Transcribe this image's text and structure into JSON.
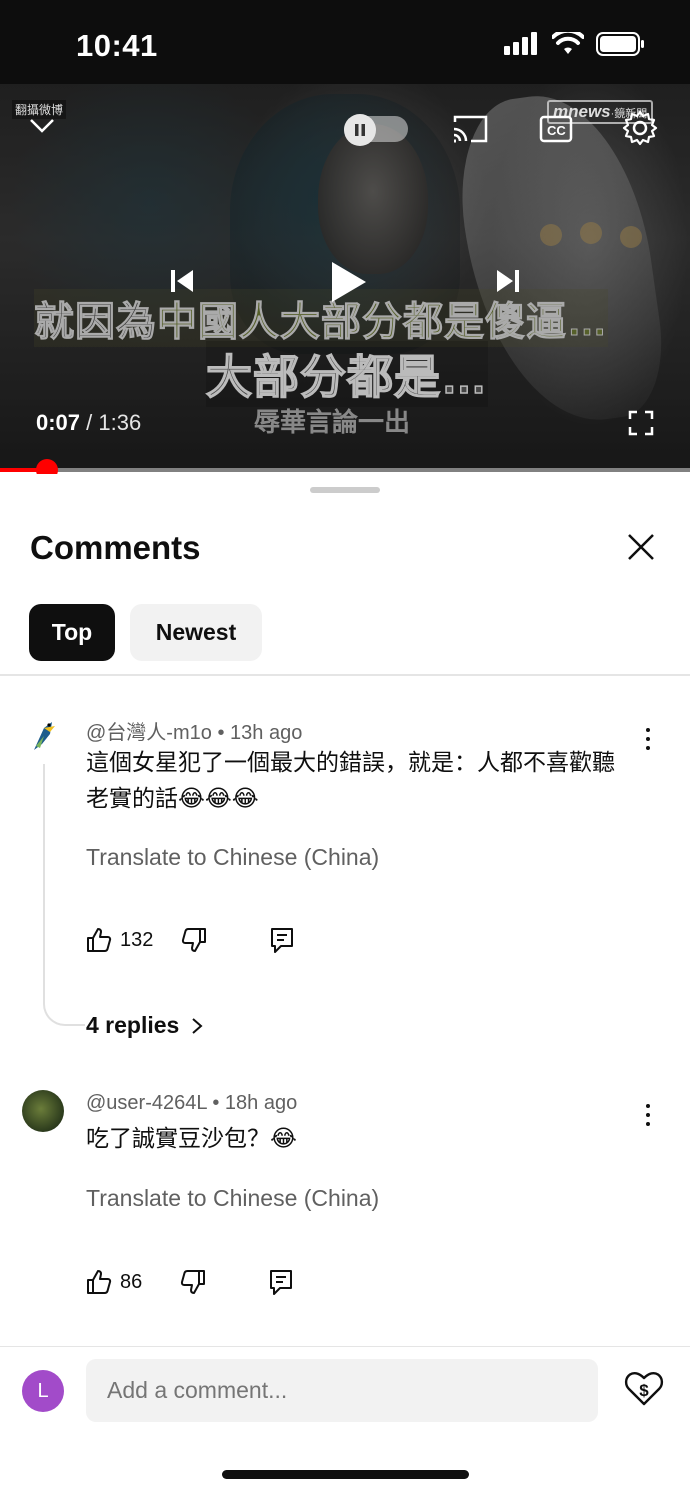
{
  "status_bar": {
    "time": "10:41",
    "icons": [
      "cellular-signal-icon",
      "wifi-icon",
      "battery-icon"
    ]
  },
  "player": {
    "watermark_left": "翻攝微博",
    "watermark_brand": "mnews",
    "watermark_brand_sub": "·鏡新聞",
    "subtitle_line1_a": "就因為",
    "subtitle_line1_b": "中國人大部分都是傻逼…",
    "subtitle_line2": "大部分都是…",
    "subtitle_line3": "辱華言論一出",
    "current_time": "0:07",
    "separator": " / ",
    "duration": "1:36",
    "progress": 0.068,
    "accent_color": "#ff0000",
    "controls": [
      "chevron-down-icon",
      "autoplay-toggle",
      "cast-icon",
      "captions-icon",
      "settings-gear-icon",
      "previous-icon",
      "play-icon",
      "next-icon",
      "fullscreen-icon"
    ]
  },
  "comments_panel": {
    "title": "Comments",
    "tabs": [
      {
        "label": "Top",
        "selected": true
      },
      {
        "label": "Newest",
        "selected": false
      }
    ],
    "comments": [
      {
        "author": "@台灣人-m1o",
        "dot": "•",
        "time": "13h ago",
        "text": "這個女星犯了一個最大的錯誤，就是：人都不喜歡聽老實的話😂😂😂",
        "translate": "Translate to Chinese (China)",
        "likes": "132",
        "replies": "4 replies"
      },
      {
        "author": "@user-4264L",
        "dot": "•",
        "time": "18h ago",
        "text": "吃了誠實豆沙包？😂",
        "translate": "Translate to Chinese (China)",
        "likes": "86"
      }
    ]
  },
  "composer": {
    "user_initial": "L",
    "placeholder": "Add a comment...",
    "user_avatar_color": "#a24bc9"
  }
}
